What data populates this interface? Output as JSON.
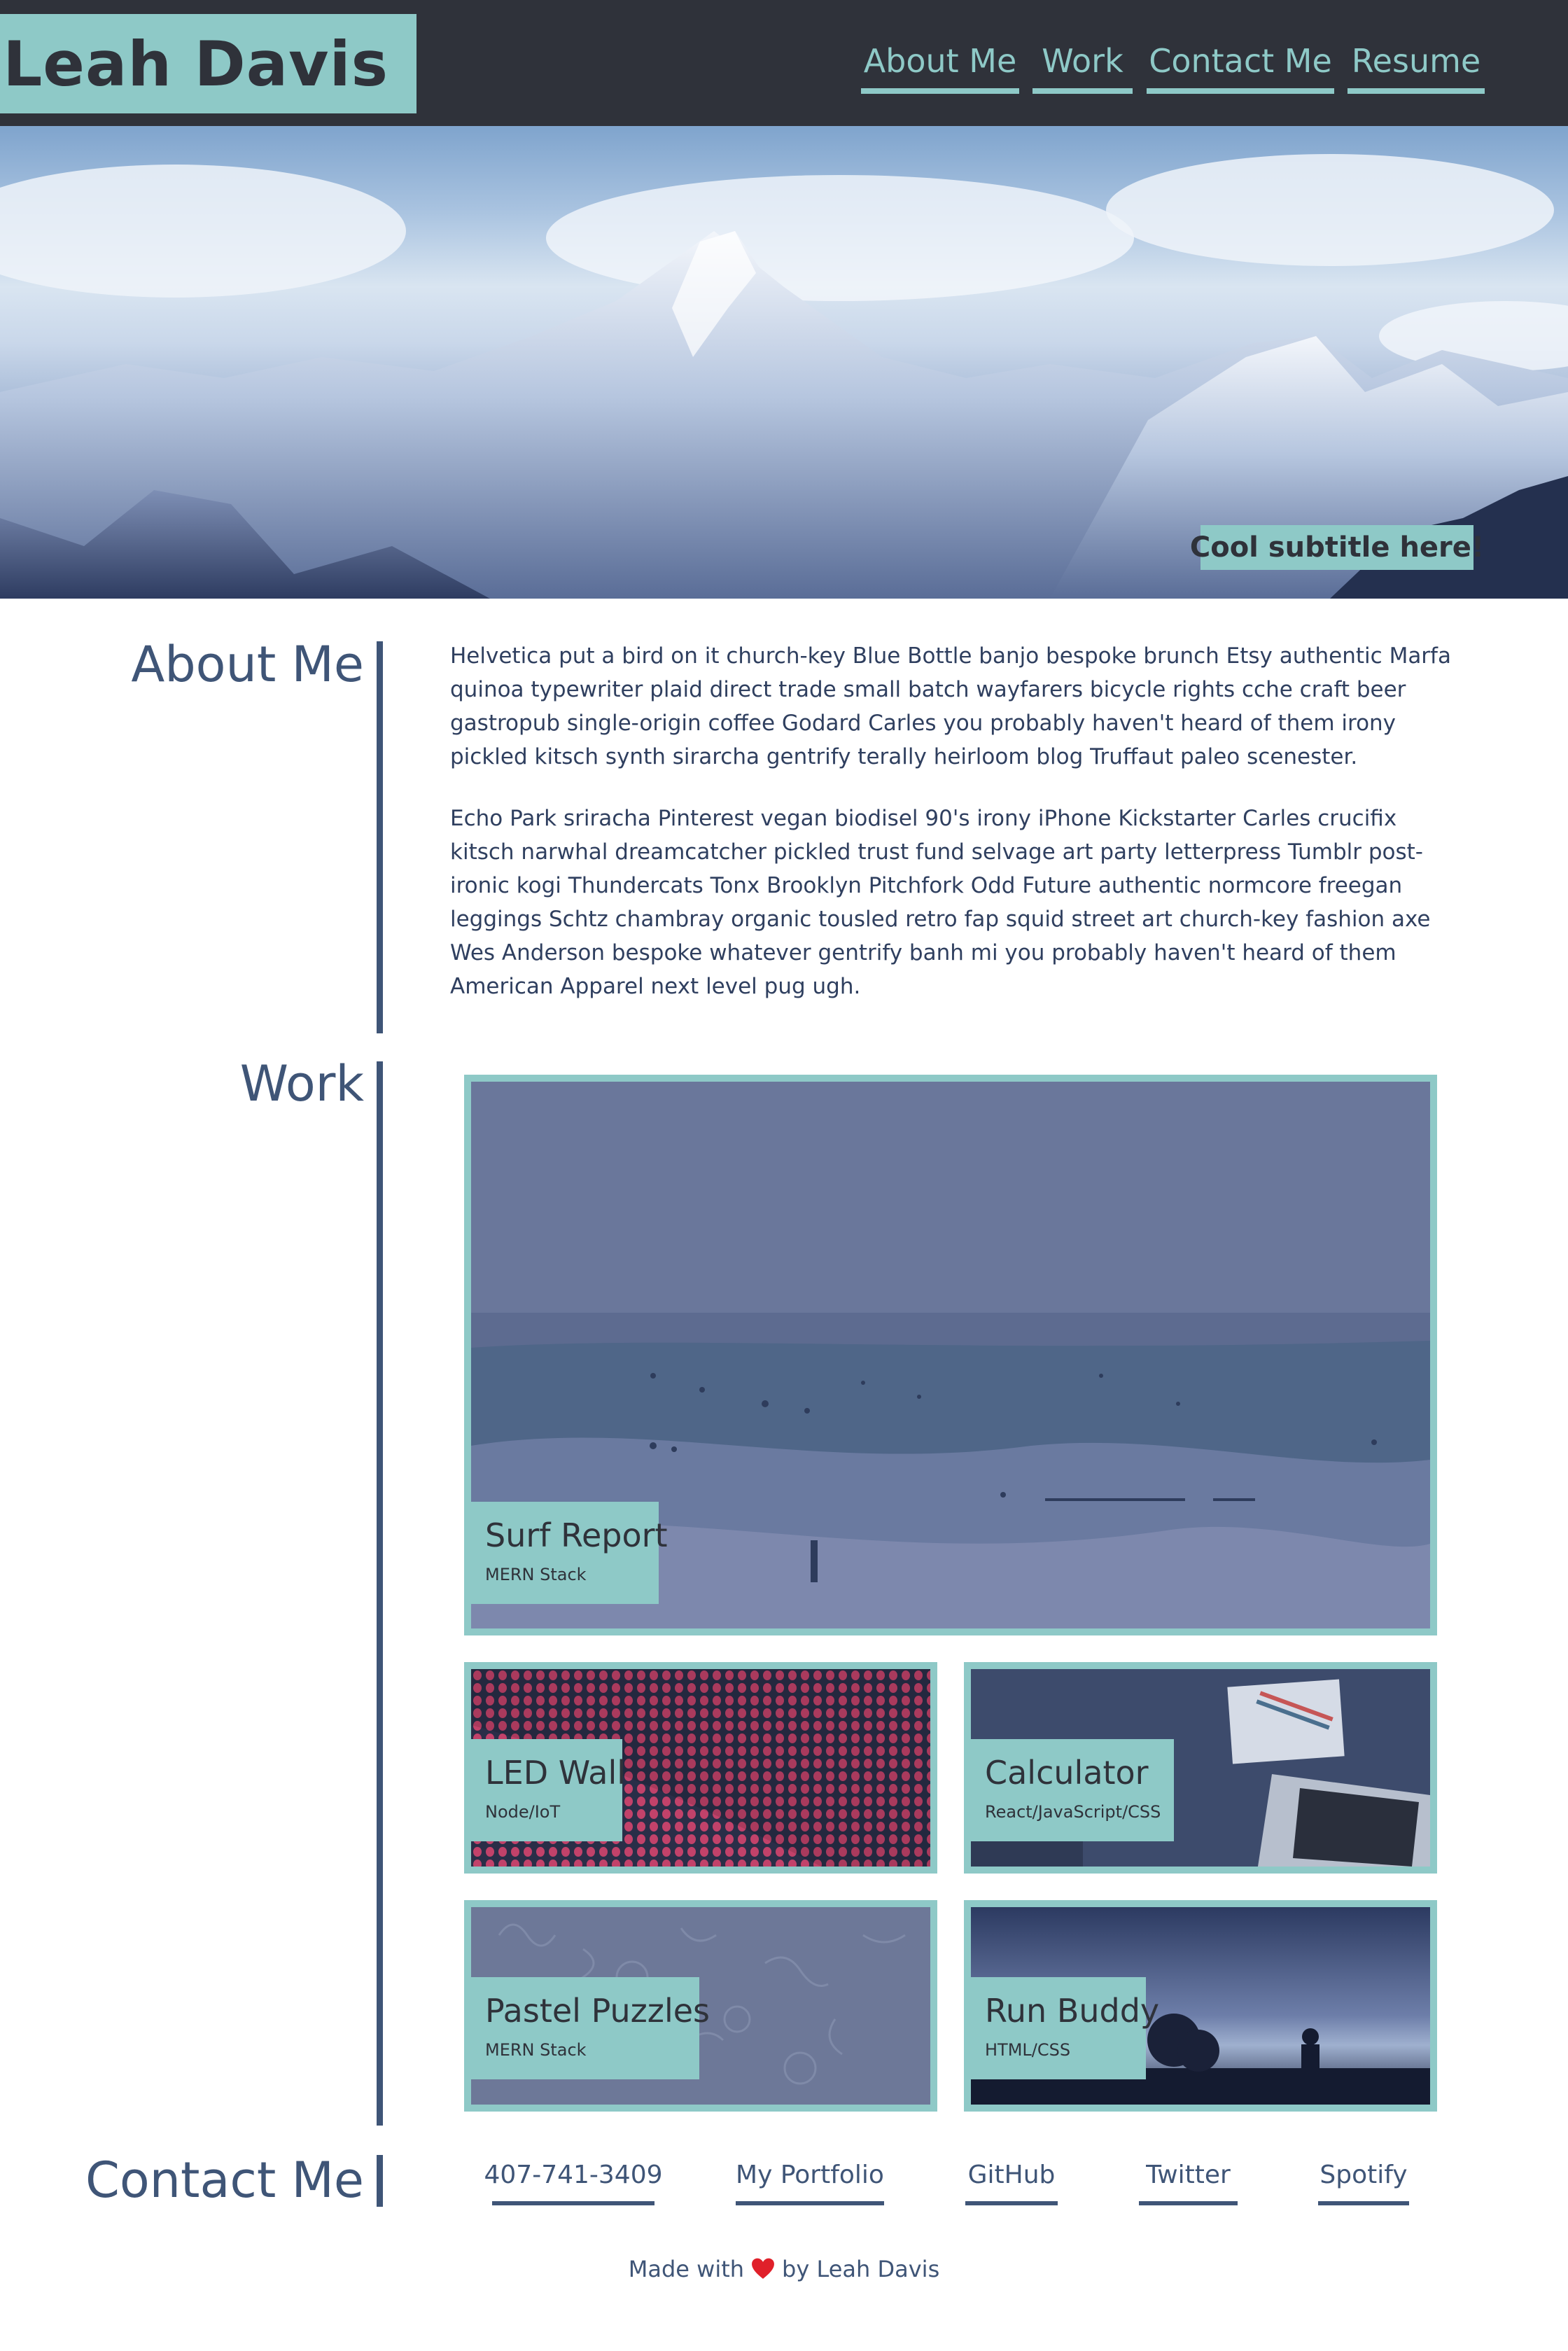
{
  "header": {
    "brand": "Leah Davis",
    "nav": [
      "About Me",
      "Work",
      "Contact Me",
      "Resume"
    ]
  },
  "hero": {
    "subtitle": "Cool subtitle here!"
  },
  "about": {
    "title": "About Me",
    "paragraphs": [
      "Helvetica put a bird on it church-key Blue Bottle banjo bespoke brunch Etsy authentic Marfa quinoa typewriter plaid direct trade small batch wayfarers bicycle rights cche craft beer gastropub single-origin coffee Godard Carles you probably haven't heard of them irony pickled kitsch synth sirarcha gentrify terally heirloom blog Truffaut paleo scenester.",
      "Echo Park sriracha Pinterest vegan biodisel 90's irony iPhone Kickstarter Carles crucifix kitsch narwhal dreamcatcher pickled trust fund selvage art party letterpress Tumblr post-ironic kogi Thundercats Tonx Brooklyn Pitchfork Odd Future authentic normcore freegan leggings Schtz chambray organic tousled retro fap squid street art church-key fashion axe Wes Anderson bespoke whatever gentrify banh mi you probably haven't heard of them American Apparel next level pug ugh."
    ]
  },
  "work": {
    "title": "Work",
    "projects": [
      {
        "name": "Surf Report",
        "stack": "MERN Stack"
      },
      {
        "name": "LED Wall",
        "stack": "Node/IoT"
      },
      {
        "name": "Calculator",
        "stack": "React/JavaScript/CSS"
      },
      {
        "name": "Pastel Puzzles",
        "stack": "MERN Stack"
      },
      {
        "name": "Run Buddy",
        "stack": "HTML/CSS"
      }
    ]
  },
  "contact": {
    "title": "Contact Me",
    "links": [
      "407-741-3409",
      "My Portfolio",
      "GitHub",
      "Twitter",
      "Spotify"
    ]
  },
  "footer": {
    "made_with": "Made with",
    "by": "by Leah Davis"
  },
  "colors": {
    "header_bg": "#2f323a",
    "accent": "#8ec9c7",
    "heading": "#3f5577"
  }
}
